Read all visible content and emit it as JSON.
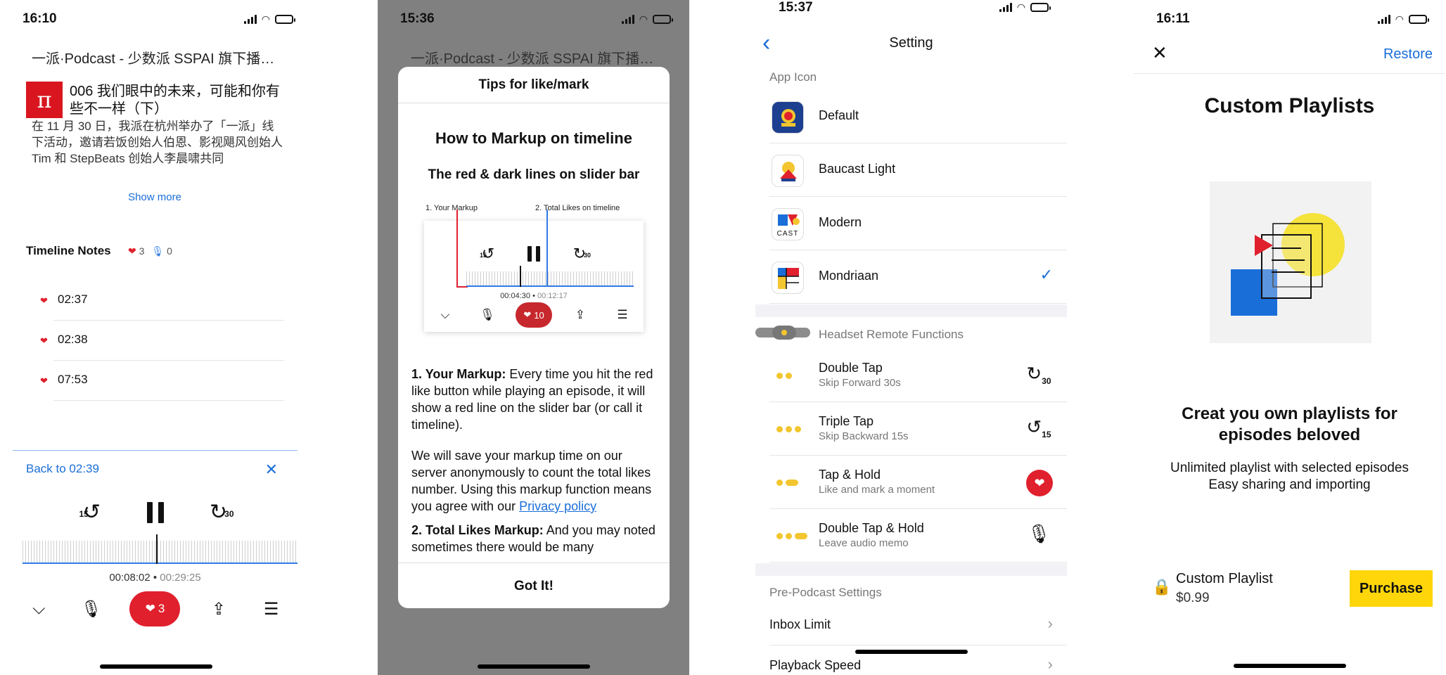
{
  "screen1": {
    "time": "16:10",
    "podcast_title": "一派·Podcast - 少数派 SSPAI 旗下播…",
    "logo_glyph": "π",
    "episode_title": "006 我们眼中的未来，可能和你有些不一样（下）",
    "description": "在 11 月 30 日，我派在杭州举办了「一派」线下活动，邀请若饭创始人伯恩、影视飓风创始人 Tim 和 StepBeats 创始人李晨啸共同",
    "show_more": "Show more",
    "timeline_notes_label": "Timeline Notes",
    "likes_count": "3",
    "memo_count": "0",
    "notes": [
      "02:37",
      "02:38",
      "07:53"
    ],
    "back_to": "Back to 02:39",
    "skip_back": "15",
    "skip_forward": "30",
    "current_time": "00:08:02",
    "total_time": "00:29:25",
    "like_button_count": "3",
    "progress_fraction": 0.486
  },
  "screen2": {
    "time": "15:36",
    "podcast_title": "一派·Podcast - 少数派 SSPAI 旗下播…",
    "modal_header": "Tips for like/mark",
    "heading": "How to Markup on timeline",
    "subheading": "The red & dark lines on slider bar",
    "label_markup": "1. Your Markup",
    "label_total": "2. Total Likes on timeline",
    "mini_skip_back": "15",
    "mini_skip_forward": "30",
    "mini_current": "00:04:30",
    "mini_total": "00:12:17",
    "mini_like_count": "10",
    "p1_bold": "1. Your Markup:",
    "p1_text": " Every time you hit the red like button while playing an episode, it will show a red line on the slider bar (or call it timeline).",
    "p2_text": "We will save your markup time on our server anonymously to count the total likes number. Using this markup function means you agree with our ",
    "p2_link": "Privacy policy",
    "p3_bold": "2. Total Likes Markup:",
    "p3_text": " And you may noted sometimes there would be many",
    "got_it": "Got It!"
  },
  "screen3": {
    "time": "15:37",
    "title": "Setting",
    "app_icon_section": "App Icon",
    "icons": [
      {
        "label": "Default",
        "selected": false
      },
      {
        "label": "Baucast Light",
        "selected": false
      },
      {
        "label": "Modern",
        "selected": false,
        "icon_text": "CAST"
      },
      {
        "label": "Mondriaan",
        "selected": true
      }
    ],
    "headset_section": "Headset Remote Functions",
    "headset": [
      {
        "title": "Double Tap",
        "subtitle": "Skip Forward 30s",
        "num": "30"
      },
      {
        "title": "Triple Tap",
        "subtitle": "Skip Backward 15s",
        "num": "15"
      },
      {
        "title": "Tap & Hold",
        "subtitle": "Like and mark a moment"
      },
      {
        "title": "Double Tap & Hold",
        "subtitle": "Leave audio memo"
      }
    ],
    "prepodcast_section": "Pre-Podcast Settings",
    "settings": [
      "Inbox Limit",
      "Playback Speed"
    ]
  },
  "screen4": {
    "time": "16:11",
    "restore": "Restore",
    "title": "Custom Playlists",
    "headline": "Creat you own playlists for episodes beloved",
    "line1": "Unlimited playlist with selected episodes",
    "line2": "Easy sharing and importing",
    "product_name": "Custom Playlist",
    "price": "$0.99",
    "purchase": "Purchase"
  },
  "colors": {
    "accent_blue": "#1a6ed8",
    "like_red": "#e0202d",
    "purchase_yellow": "#ffd60a",
    "dot_yellow": "#f3c62f"
  }
}
